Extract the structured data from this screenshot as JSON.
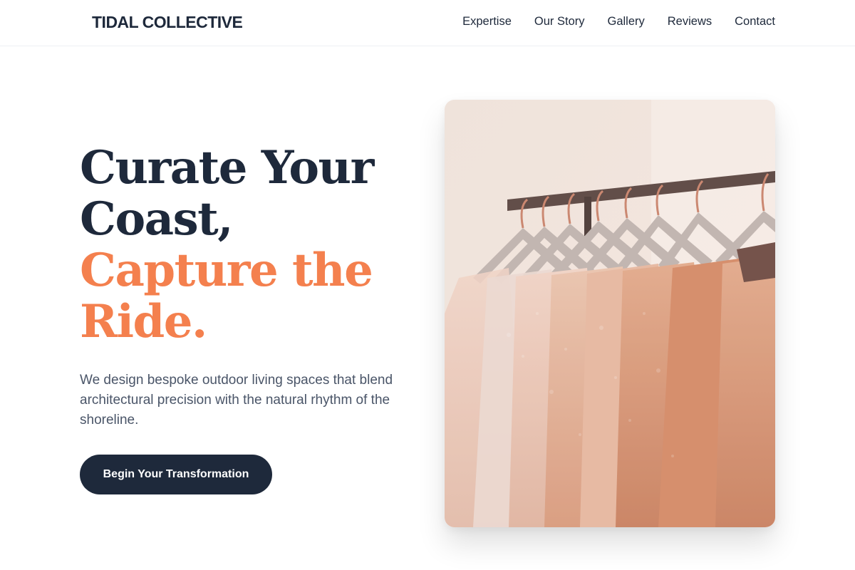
{
  "brand": {
    "name": "TIDAL COLLECTIVE"
  },
  "nav": {
    "links": [
      {
        "label": "Expertise"
      },
      {
        "label": "Our Story"
      },
      {
        "label": "Gallery"
      },
      {
        "label": "Reviews"
      },
      {
        "label": "Contact"
      }
    ]
  },
  "hero": {
    "headline_lines": [
      "Curate Your",
      "Coast,"
    ],
    "headline_accent_lines": [
      "Capture the",
      "Ride."
    ],
    "subtitle": "We design bespoke outdoor living spaces that blend architectural precision with the natural rhythm of the shoreline.",
    "cta_label": "Begin Your Transformation",
    "image": {
      "subject": "clothing-rack-photo"
    }
  },
  "colors": {
    "primary": "#1e293b",
    "accent": "#f4804e",
    "muted_text": "#4a5568",
    "background": "#ffffff"
  }
}
